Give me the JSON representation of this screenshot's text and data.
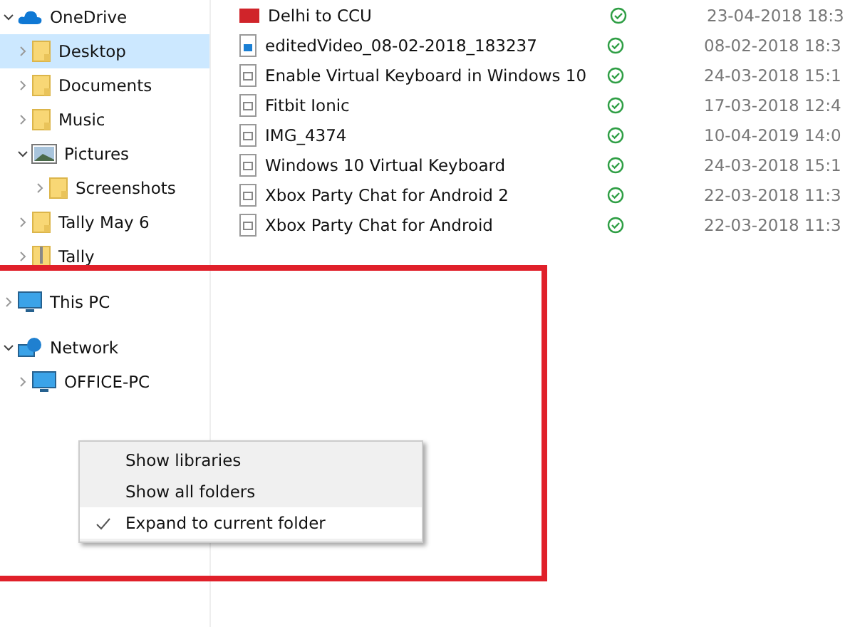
{
  "navigation": {
    "tree": [
      {
        "label": "OneDrive",
        "kind": "cloud",
        "expanded": true,
        "selected": false,
        "children": [
          {
            "label": "Desktop",
            "kind": "folder",
            "expanded": false,
            "selected": true
          },
          {
            "label": "Documents",
            "kind": "folder",
            "expanded": false,
            "selected": false
          },
          {
            "label": "Music",
            "kind": "folder",
            "expanded": false,
            "selected": false
          },
          {
            "label": "Pictures",
            "kind": "pictures",
            "expanded": true,
            "selected": false,
            "children": [
              {
                "label": "Screenshots",
                "kind": "folder",
                "expanded": false,
                "selected": false
              }
            ]
          },
          {
            "label": "Tally May 6",
            "kind": "folder",
            "expanded": false,
            "selected": false
          },
          {
            "label": "Tally",
            "kind": "zip",
            "expanded": false,
            "selected": false
          }
        ]
      },
      {
        "label": "This PC",
        "kind": "pc",
        "expanded": false,
        "selected": false
      },
      {
        "label": "Network",
        "kind": "network",
        "expanded": true,
        "selected": false,
        "children": [
          {
            "label": "OFFICE-PC",
            "kind": "pc",
            "expanded": false,
            "selected": false
          }
        ]
      }
    ]
  },
  "files": [
    {
      "name": "Delhi to CCU",
      "kind": "pdf",
      "date": "23-04-2018 18:3"
    },
    {
      "name": "editedVideo_08-02-2018_183237",
      "kind": "video",
      "date": "08-02-2018 18:3"
    },
    {
      "name": "Enable Virtual Keyboard in Windows 10",
      "kind": "document",
      "date": "24-03-2018 15:1"
    },
    {
      "name": "Fitbit Ionic",
      "kind": "document",
      "date": "17-03-2018 12:4"
    },
    {
      "name": "IMG_4374",
      "kind": "document",
      "date": "10-04-2019 14:0"
    },
    {
      "name": "Windows 10 Virtual Keyboard",
      "kind": "document",
      "date": "24-03-2018 15:1"
    },
    {
      "name": "Xbox Party Chat for Android 2",
      "kind": "document",
      "date": "22-03-2018 11:3"
    },
    {
      "name": "Xbox Party Chat for Android",
      "kind": "document",
      "date": "22-03-2018 11:3"
    }
  ],
  "context_menu": {
    "items": [
      {
        "label": "Show libraries",
        "checked": false,
        "highlighted": false
      },
      {
        "label": "Show all folders",
        "checked": false,
        "highlighted": false
      },
      {
        "label": "Expand to current folder",
        "checked": true,
        "highlighted": true
      }
    ]
  }
}
